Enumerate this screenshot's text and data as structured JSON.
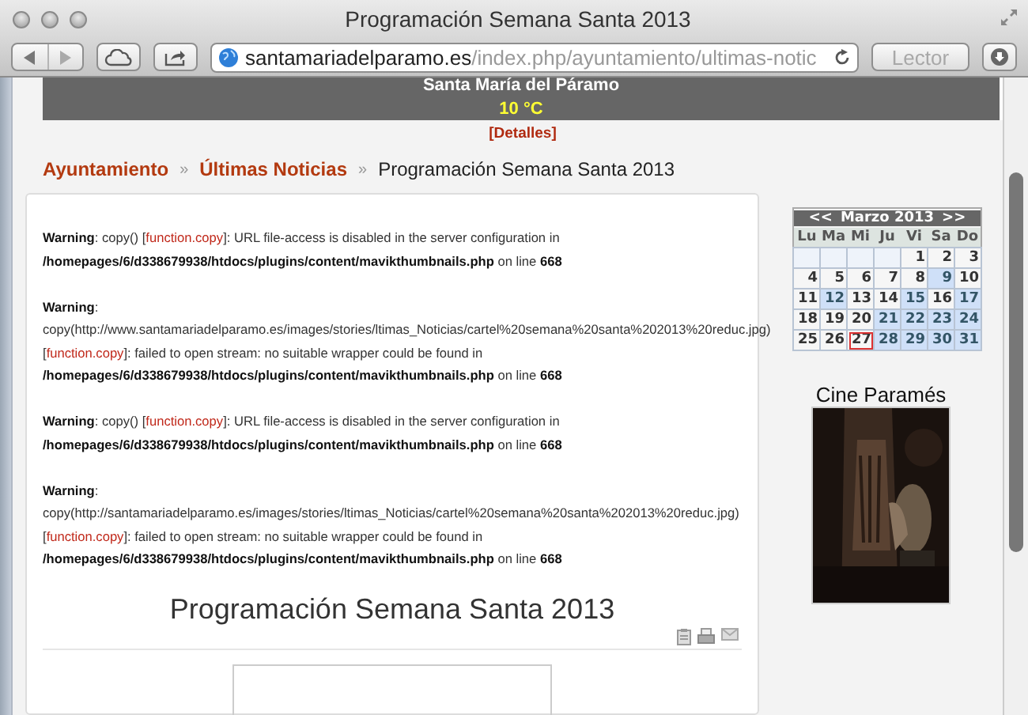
{
  "window": {
    "title": "Programación Semana Santa 2013"
  },
  "toolbar": {
    "url_host": "santamariadelparamo.es",
    "url_path": "/index.php/ayuntamiento/ultimas-notic",
    "reader_button": "Lector"
  },
  "weather": {
    "location": "Santa María del Páramo",
    "temperature": "10 °C",
    "details_link": "[Detalles]"
  },
  "breadcrumb": [
    {
      "label": "Ayuntamiento",
      "kind": "link"
    },
    {
      "label": "»",
      "kind": "separator"
    },
    {
      "label": "Últimas Noticias",
      "kind": "link"
    },
    {
      "label": "»",
      "kind": "separator"
    },
    {
      "label": "Programación Semana Santa 2013",
      "kind": "current"
    }
  ],
  "warnings": [
    [
      [
        {
          "text": "Warning",
          "kind": "label"
        },
        {
          "text": ": copy() [",
          "kind": "plain"
        },
        {
          "text": "function.copy",
          "kind": "function"
        },
        {
          "text": "]: URL file-access is disabled in the server configuration in",
          "kind": "plain"
        }
      ],
      [
        {
          "text": "/homepages/6/d338679938/htdocs/plugins/content/mavikthumbnails.php",
          "kind": "path"
        },
        {
          "text": " on line ",
          "kind": "plain"
        },
        {
          "text": "668",
          "kind": "path"
        }
      ]
    ],
    [
      [
        {
          "text": "Warning",
          "kind": "label"
        },
        {
          "text": ":",
          "kind": "plain"
        }
      ],
      [
        {
          "text": "copy(http://www.santamariadelparamo.es/images/stories/ltimas_Noticias/cartel%20semana%20santa%202013%20reduc.jpg)",
          "kind": "plain"
        }
      ],
      [
        {
          "text": "[",
          "kind": "plain"
        },
        {
          "text": "function.copy",
          "kind": "function"
        },
        {
          "text": "]: failed to open stream: no suitable wrapper could be found in",
          "kind": "plain"
        }
      ],
      [
        {
          "text": "/homepages/6/d338679938/htdocs/plugins/content/mavikthumbnails.php",
          "kind": "path"
        },
        {
          "text": " on line ",
          "kind": "plain"
        },
        {
          "text": "668",
          "kind": "path"
        }
      ]
    ],
    [
      [
        {
          "text": "Warning",
          "kind": "label"
        },
        {
          "text": ": copy() [",
          "kind": "plain"
        },
        {
          "text": "function.copy",
          "kind": "function"
        },
        {
          "text": "]: URL file-access is disabled in the server configuration in",
          "kind": "plain"
        }
      ],
      [
        {
          "text": "/homepages/6/d338679938/htdocs/plugins/content/mavikthumbnails.php",
          "kind": "path"
        },
        {
          "text": " on line ",
          "kind": "plain"
        },
        {
          "text": "668",
          "kind": "path"
        }
      ]
    ],
    [
      [
        {
          "text": "Warning",
          "kind": "label"
        },
        {
          "text": ":",
          "kind": "plain"
        }
      ],
      [
        {
          "text": "copy(http://santamariadelparamo.es/images/stories/ltimas_Noticias/cartel%20semana%20santa%202013%20reduc.jpg)",
          "kind": "plain"
        }
      ],
      [
        {
          "text": "[",
          "kind": "plain"
        },
        {
          "text": "function.copy",
          "kind": "function"
        },
        {
          "text": "]: failed to open stream: no suitable wrapper could be found in",
          "kind": "plain"
        }
      ],
      [
        {
          "text": "/homepages/6/d338679938/htdocs/plugins/content/mavikthumbnails.php",
          "kind": "path"
        },
        {
          "text": " on line ",
          "kind": "plain"
        },
        {
          "text": "668",
          "kind": "path"
        }
      ]
    ]
  ],
  "article": {
    "title": "Programación Semana Santa 2013"
  },
  "calendar": {
    "prev": "<<",
    "month": "Marzo 2013",
    "next": ">>",
    "weekdays": [
      "Lu",
      "Ma",
      "Mi",
      "Ju",
      "Vi",
      "Sa",
      "Do"
    ],
    "weeks": [
      [
        {
          "kind": "empty"
        },
        {
          "kind": "empty"
        },
        {
          "kind": "empty"
        },
        {
          "kind": "empty"
        },
        {
          "kind": "day",
          "day": "1",
          "highlighted": false,
          "today": false
        },
        {
          "kind": "day",
          "day": "2",
          "highlighted": false,
          "today": false
        },
        {
          "kind": "day",
          "day": "3",
          "highlighted": false,
          "today": false
        }
      ],
      [
        {
          "kind": "day",
          "day": "4",
          "highlighted": false,
          "today": false
        },
        {
          "kind": "day",
          "day": "5",
          "highlighted": false,
          "today": false
        },
        {
          "kind": "day",
          "day": "6",
          "highlighted": false,
          "today": false
        },
        {
          "kind": "day",
          "day": "7",
          "highlighted": false,
          "today": false
        },
        {
          "kind": "day",
          "day": "8",
          "highlighted": false,
          "today": false
        },
        {
          "kind": "day",
          "day": "9",
          "highlighted": true,
          "today": false
        },
        {
          "kind": "day",
          "day": "10",
          "highlighted": false,
          "today": false
        }
      ],
      [
        {
          "kind": "day",
          "day": "11",
          "highlighted": false,
          "today": false
        },
        {
          "kind": "day",
          "day": "12",
          "highlighted": true,
          "today": false
        },
        {
          "kind": "day",
          "day": "13",
          "highlighted": false,
          "today": false
        },
        {
          "kind": "day",
          "day": "14",
          "highlighted": false,
          "today": false
        },
        {
          "kind": "day",
          "day": "15",
          "highlighted": true,
          "today": false
        },
        {
          "kind": "day",
          "day": "16",
          "highlighted": false,
          "today": false
        },
        {
          "kind": "day",
          "day": "17",
          "highlighted": true,
          "today": false
        }
      ],
      [
        {
          "kind": "day",
          "day": "18",
          "highlighted": false,
          "today": false
        },
        {
          "kind": "day",
          "day": "19",
          "highlighted": false,
          "today": false
        },
        {
          "kind": "day",
          "day": "20",
          "highlighted": false,
          "today": false
        },
        {
          "kind": "day",
          "day": "21",
          "highlighted": true,
          "today": false
        },
        {
          "kind": "day",
          "day": "22",
          "highlighted": true,
          "today": false
        },
        {
          "kind": "day",
          "day": "23",
          "highlighted": true,
          "today": false
        },
        {
          "kind": "day",
          "day": "24",
          "highlighted": true,
          "today": false
        }
      ],
      [
        {
          "kind": "day",
          "day": "25",
          "highlighted": false,
          "today": false
        },
        {
          "kind": "day",
          "day": "26",
          "highlighted": false,
          "today": false
        },
        {
          "kind": "day",
          "day": "27",
          "highlighted": false,
          "today": true
        },
        {
          "kind": "day",
          "day": "28",
          "highlighted": true,
          "today": false
        },
        {
          "kind": "day",
          "day": "29",
          "highlighted": true,
          "today": false
        },
        {
          "kind": "day",
          "day": "30",
          "highlighted": true,
          "today": false
        },
        {
          "kind": "day",
          "day": "31",
          "highlighted": true,
          "today": false
        }
      ]
    ]
  },
  "cinema": {
    "title": "Cine Paramés"
  }
}
